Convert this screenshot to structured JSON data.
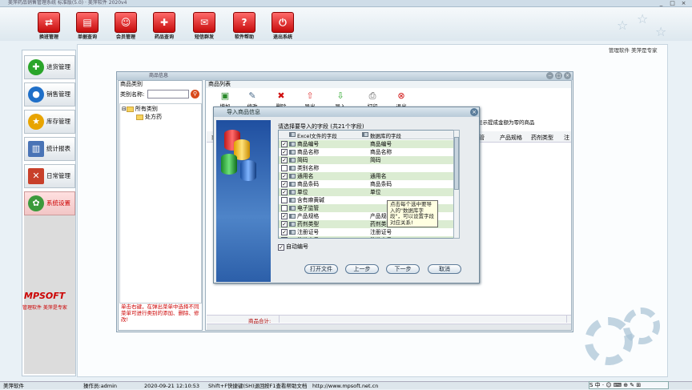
{
  "window": {
    "title": "美萍药品销售管理系统 标准版(5.0) · 美萍软件 2020v4",
    "controls": [
      "_",
      "□",
      "×"
    ]
  },
  "toolbar": {
    "buttons": [
      {
        "label": "换班管理",
        "icon": "shift-icon"
      },
      {
        "label": "单据查询",
        "icon": "document-search-icon"
      },
      {
        "label": "会员管理",
        "icon": "member-icon"
      },
      {
        "label": "药品查询",
        "icon": "medicine-search-icon"
      },
      {
        "label": "短信群发",
        "icon": "sms-icon"
      },
      {
        "label": "软件帮助",
        "icon": "help-icon"
      },
      {
        "label": "退出系统",
        "icon": "exit-icon"
      }
    ]
  },
  "sidebar": {
    "items": [
      {
        "label": "进货管理",
        "icon": "plus-icon",
        "color": "#2aa52a"
      },
      {
        "label": "销售管理",
        "icon": "globe-icon",
        "color": "#1f6fc8"
      },
      {
        "label": "库存管理",
        "icon": "star-icon",
        "color": "#e8a400"
      },
      {
        "label": "统计报表",
        "icon": "chart-icon",
        "color": "#4a74b6"
      },
      {
        "label": "日常管理",
        "icon": "tools-icon",
        "color": "#c8402a"
      },
      {
        "label": "系统设置",
        "icon": "gear-icon",
        "color": "#3c9a3c"
      }
    ],
    "logo": "MPSOFT",
    "logo_sub": "管理软件 美萍是专家"
  },
  "brand_top": "管理软件 美萍是专家",
  "inner_window": {
    "title": "商品信息",
    "controls": [
      "−",
      "□",
      "×"
    ]
  },
  "category_panel": {
    "header": "商品类别",
    "search_label": "类别名称:",
    "search_value": "",
    "tree": [
      {
        "toggle": "⊟",
        "label": "所有类别"
      },
      {
        "label": "处方药"
      }
    ],
    "hint": "单击右键，在弹出菜单中选择不同菜单可进行类别的添加、删除、修改!"
  },
  "list_panel": {
    "header": "商品列表",
    "tools": [
      {
        "label": "增加",
        "icon": "add-icon"
      },
      {
        "label": "修改",
        "icon": "edit-icon"
      },
      {
        "label": "删除",
        "icon": "delete-icon"
      },
      {
        "label": "导出",
        "icon": "export-icon"
      },
      {
        "label": "导入",
        "icon": "import-icon"
      },
      {
        "label": "打印",
        "icon": "print-icon"
      },
      {
        "label": "退出",
        "icon": "exit-icon"
      }
    ],
    "info": "显示提成金额为零的商品",
    "columns": [
      "商",
      "产品规格",
      "药剂类型",
      "注"
    ],
    "columns_right": [
      "管",
      "产品规格",
      "药剂类型",
      "注"
    ],
    "sum_label": "商品合计:"
  },
  "dialog": {
    "title": "导入商品信息",
    "prompt": "请选择要导入的字段 (共21个字段)",
    "col_excel": "Excel文件的字段",
    "col_db": "数据库的字段",
    "rows": [
      {
        "checked": true,
        "excel": "商品编号",
        "db": "商品编号"
      },
      {
        "checked": true,
        "excel": "商品名称",
        "db": "商品名称"
      },
      {
        "checked": true,
        "excel": "简码",
        "db": "简码"
      },
      {
        "checked": false,
        "excel": "类别名称",
        "db": ""
      },
      {
        "checked": true,
        "excel": "通用名",
        "db": "通用名"
      },
      {
        "checked": true,
        "excel": "商品条码",
        "db": "商品条码"
      },
      {
        "checked": true,
        "excel": "单位",
        "db": "单位"
      },
      {
        "checked": false,
        "excel": "含有麻黄碱",
        "db": ""
      },
      {
        "checked": false,
        "excel": "电子监管",
        "db": ""
      },
      {
        "checked": true,
        "excel": "产品规格",
        "db": "产品规格"
      },
      {
        "checked": true,
        "excel": "药剂类型",
        "db": "药剂类型"
      },
      {
        "checked": true,
        "excel": "注册证号",
        "db": "注册证号"
      },
      {
        "checked": true,
        "excel": "批准文号",
        "db": "批准文号"
      }
    ],
    "tooltip": "点击每个选中要导入的\"数据库字段\"，可以设置字段对应关系!",
    "auto_number": {
      "checked": true,
      "label": "自动编号"
    },
    "buttons": {
      "open": "打开文件",
      "prev": "上一步",
      "next": "下一步",
      "cancel": "取消"
    }
  },
  "statusbar": {
    "app": "美萍软件",
    "operator": "操作员:admin",
    "datetime": "2020-09-21 12:10:53",
    "hint": "Shift+F快捷键(SH)退回",
    "help": "按F1查看帮助文档",
    "url": "http://www.mpsoft.net.cn"
  },
  "ime": {
    "label": "S 中 · ☺ ⌨ ⊕ ✎ ⊞"
  }
}
